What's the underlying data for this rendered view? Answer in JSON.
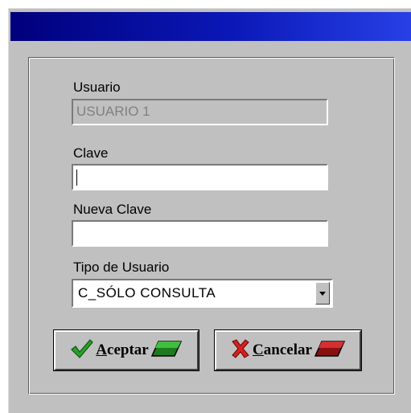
{
  "dialog": {
    "usuario_label": "Usuario",
    "usuario_value": "USUARIO 1",
    "clave_label": "Clave",
    "clave_value": "",
    "nueva_clave_label": "Nueva Clave",
    "nueva_clave_value": "",
    "tipo_label": "Tipo de Usuario",
    "tipo_value": "C_SÓLO CONSULTA"
  },
  "buttons": {
    "accept_access_key": "A",
    "accept_rest": "ceptar",
    "accept_icon": "checkmark-icon",
    "accept_color": "#1a8a1a",
    "cancel_access_key": "C",
    "cancel_rest": "ancelar",
    "cancel_icon": "x-mark-icon",
    "cancel_color": "#c01818"
  },
  "colors": {
    "titlebar_start": "#00007b",
    "titlebar_end": "#2740e6",
    "dialog_background": "#c0c0c0"
  }
}
